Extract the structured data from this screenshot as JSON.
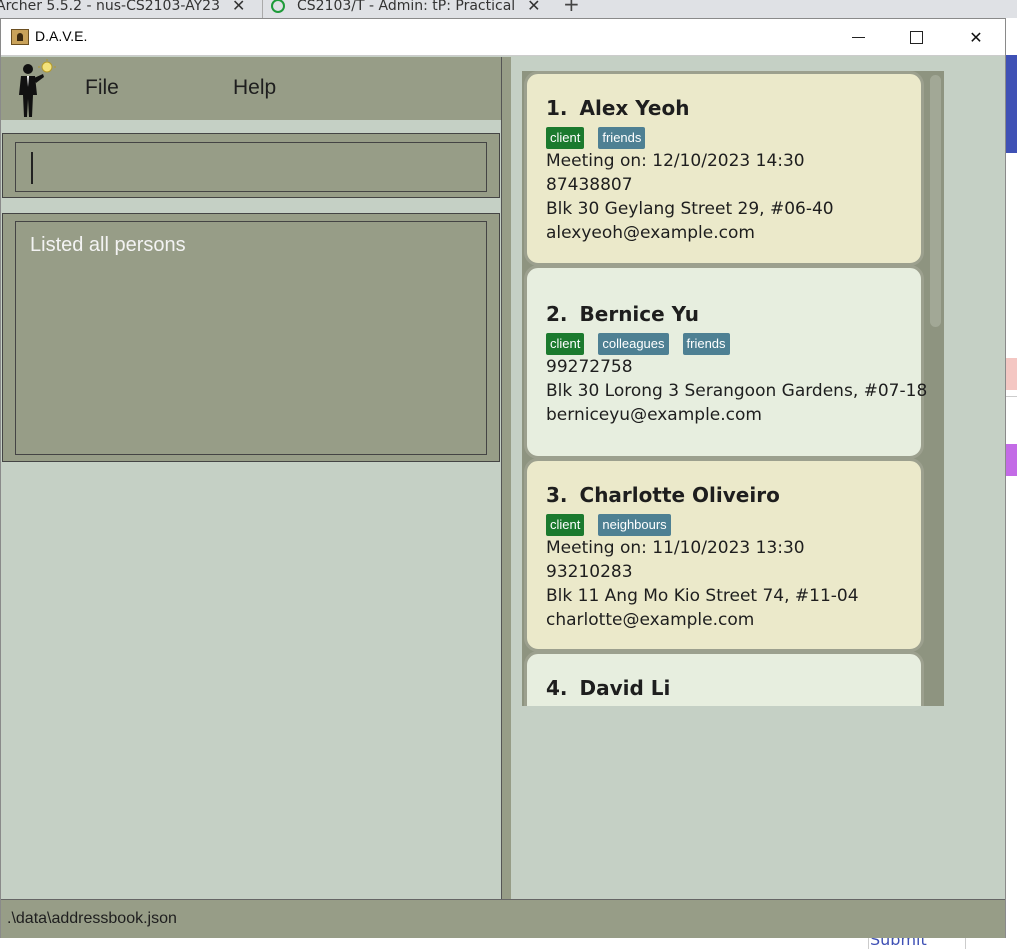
{
  "browser": {
    "tab1_title": "Archer 5.5.2 - nus-CS2103-AY23",
    "tab2_title": "CS2103/T - Admin: tP: Practical"
  },
  "background_page": {
    "submit_label": "Submit"
  },
  "window": {
    "title": "D.A.V.E."
  },
  "menu": {
    "file_label": "File",
    "help_label": "Help"
  },
  "command_box": {
    "value": ""
  },
  "result_display": {
    "text": "Listed all persons"
  },
  "persons": [
    {
      "index": "1.",
      "name": "Alex Yeoh",
      "tags": [
        "client",
        "friends"
      ],
      "meeting": "Meeting on: 12/10/2023 14:30",
      "phone": "87438807",
      "address": "Blk 30 Geylang Street 29, #06-40",
      "email": "alexyeoh@example.com",
      "color": "#ebe9ca"
    },
    {
      "index": "2.",
      "name": "Bernice Yu",
      "tags": [
        "client",
        "colleagues",
        "friends"
      ],
      "meeting": "",
      "phone": "99272758",
      "address": "Blk 30 Lorong 3 Serangoon Gardens, #07-18",
      "email": "berniceyu@example.com",
      "color": "#e7eedf"
    },
    {
      "index": "3.",
      "name": "Charlotte Oliveiro",
      "tags": [
        "client",
        "neighbours"
      ],
      "meeting": "Meeting on: 11/10/2023 13:30",
      "phone": "93210283",
      "address": "Blk 11 Ang Mo Kio Street 74, #11-04",
      "email": "charlotte@example.com",
      "color": "#ebe9ca"
    },
    {
      "index": "4.",
      "name": "David Li",
      "tags": [],
      "meeting": "",
      "phone": "",
      "address": "",
      "email": "",
      "color": "#e7eedf"
    }
  ],
  "status_bar": {
    "path": ".\\data\\addressbook.json"
  }
}
